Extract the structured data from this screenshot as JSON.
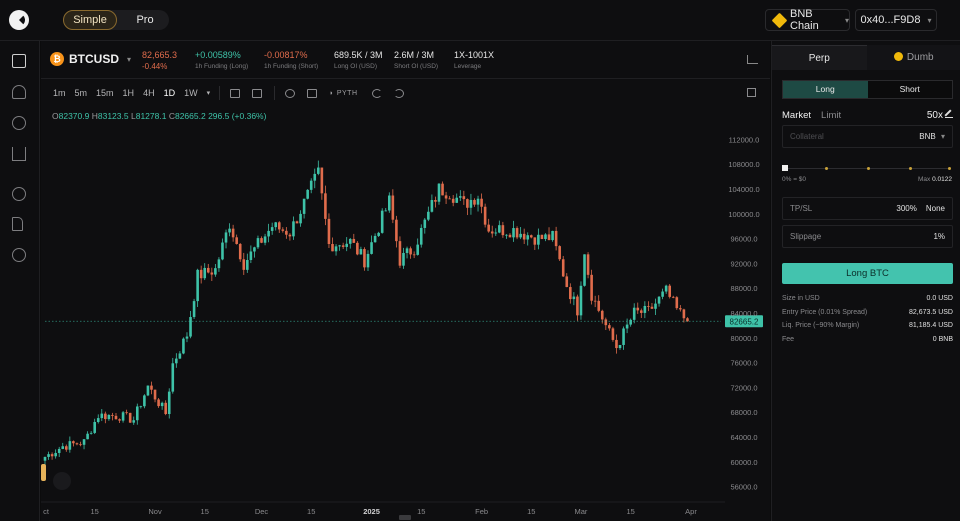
{
  "header": {
    "mode_simple": "Simple",
    "mode_pro": "Pro",
    "chain": "BNB Chain",
    "wallet": "0x40...F9D8"
  },
  "ticker": {
    "symbol": "BTCUSD",
    "price": "82,665.3",
    "change": "-0.44%",
    "funding_long": "+0.00589%",
    "funding_long_label": "1h Funding (Long)",
    "funding_short": "-0.00817%",
    "funding_short_label": "1h Funding (Short)",
    "long_oi": "689.5K / 3M",
    "long_oi_label": "Long OI (USD)",
    "short_oi": "2.6M / 3M",
    "short_oi_label": "Short OI (USD)",
    "leverage": "1X-1001X",
    "leverage_label": "Leverage"
  },
  "toolbar": {
    "timeframes": [
      "1m",
      "5m",
      "15m",
      "1H",
      "4H",
      "1D",
      "1W"
    ],
    "active_timeframe": "1D",
    "powered_by": "PYTH"
  },
  "ohlc": {
    "open": "82370.9",
    "high": "83123.5",
    "low": "81278.1",
    "close": "82665.2",
    "change": "296.5 (+0.36%)"
  },
  "chart_data": {
    "type": "candlestick",
    "symbol": "BTCUSD",
    "interval": "1D",
    "ylim": [
      54000,
      114000
    ],
    "y_ticks": [
      112000,
      108000,
      104000,
      100000,
      96000,
      92000,
      88000,
      84000,
      80000,
      76000,
      72000,
      68000,
      64000,
      60000,
      56000
    ],
    "x_ticks": [
      {
        "label": "ct",
        "date": "2024-10-01"
      },
      {
        "label": "15",
        "date": "2024-10-15"
      },
      {
        "label": "Nov",
        "date": "2024-11-01"
      },
      {
        "label": "15",
        "date": "2024-11-15"
      },
      {
        "label": "Dec",
        "date": "2024-12-01"
      },
      {
        "label": "15",
        "date": "2024-12-15"
      },
      {
        "label": "2025",
        "date": "2025-01-01"
      },
      {
        "label": "15",
        "date": "2025-01-15"
      },
      {
        "label": "Feb",
        "date": "2025-02-01"
      },
      {
        "label": "15",
        "date": "2025-02-15"
      },
      {
        "label": "Mar",
        "date": "2025-03-01"
      },
      {
        "label": "15",
        "date": "2025-03-15"
      },
      {
        "label": "Apr",
        "date": "2025-04-01"
      }
    ],
    "last_price": "82665.2",
    "last_price_value": 82665.2,
    "colors": {
      "up": "#3ec2a8",
      "down": "#e06c4c"
    },
    "grid": false,
    "start_date": "2024-10-01",
    "close_path": [
      [
        "2024-10-01",
        60800
      ],
      [
        "2024-10-06",
        62500
      ],
      [
        "2024-10-12",
        63200
      ],
      [
        "2024-10-16",
        67500
      ],
      [
        "2024-10-22",
        67400
      ],
      [
        "2024-10-26",
        66800
      ],
      [
        "2024-10-30",
        72200
      ],
      [
        "2024-11-04",
        67800
      ],
      [
        "2024-11-06",
        75800
      ],
      [
        "2024-11-10",
        80500
      ],
      [
        "2024-11-13",
        90000
      ],
      [
        "2024-11-18",
        91000
      ],
      [
        "2024-11-22",
        98500
      ],
      [
        "2024-11-26",
        92000
      ],
      [
        "2024-12-04",
        98000
      ],
      [
        "2024-12-09",
        97000
      ],
      [
        "2024-12-17",
        106500
      ],
      [
        "2024-12-20",
        95000
      ],
      [
        "2024-12-26",
        95500
      ],
      [
        "2024-12-30",
        92500
      ],
      [
        "2025-01-06",
        102000
      ],
      [
        "2025-01-09",
        92500
      ],
      [
        "2025-01-13",
        94500
      ],
      [
        "2025-01-20",
        104000
      ],
      [
        "2025-01-23",
        103500
      ],
      [
        "2025-01-27",
        101500
      ],
      [
        "2025-01-31",
        103000
      ],
      [
        "2025-02-03",
        97500
      ],
      [
        "2025-02-10",
        97400
      ],
      [
        "2025-02-17",
        96000
      ],
      [
        "2025-02-21",
        96200
      ],
      [
        "2025-02-25",
        88500
      ],
      [
        "2025-02-28",
        84500
      ],
      [
        "2025-03-02",
        94200
      ],
      [
        "2025-03-04",
        87000
      ],
      [
        "2025-03-09",
        80700
      ],
      [
        "2025-03-11",
        78500
      ],
      [
        "2025-03-16",
        84000
      ],
      [
        "2025-03-20",
        84200
      ],
      [
        "2025-03-25",
        87500
      ],
      [
        "2025-03-28",
        84500
      ],
      [
        "2025-03-31",
        82665
      ]
    ]
  },
  "order": {
    "tab_perp": "Perp",
    "tab_dumb": "Dumb",
    "side_long": "Long",
    "side_short": "Short",
    "type_market": "Market",
    "type_limit": "Limit",
    "leverage": "50x",
    "collateral_placeholder": "Collateral",
    "collateral_currency": "BNB",
    "slider_value": 0,
    "slider_min": "0% = $0",
    "slider_max_label": "Max",
    "slider_max": "0.0122",
    "tpsl_label": "TP/SL",
    "tp_value": "300%",
    "sl_value": "None",
    "slippage_label": "Slippage",
    "slippage_value": "1%",
    "submit": "Long BTC",
    "summary": [
      {
        "label": "Size in USD",
        "value": "0.0 USD"
      },
      {
        "label": "Entry Price (0.01% Spread)",
        "value": "82,673.5 USD"
      },
      {
        "label": "Liq. Price (~90% Margin)",
        "value": "81,185.4 USD"
      },
      {
        "label": "Fee",
        "value": "0 BNB"
      }
    ]
  }
}
